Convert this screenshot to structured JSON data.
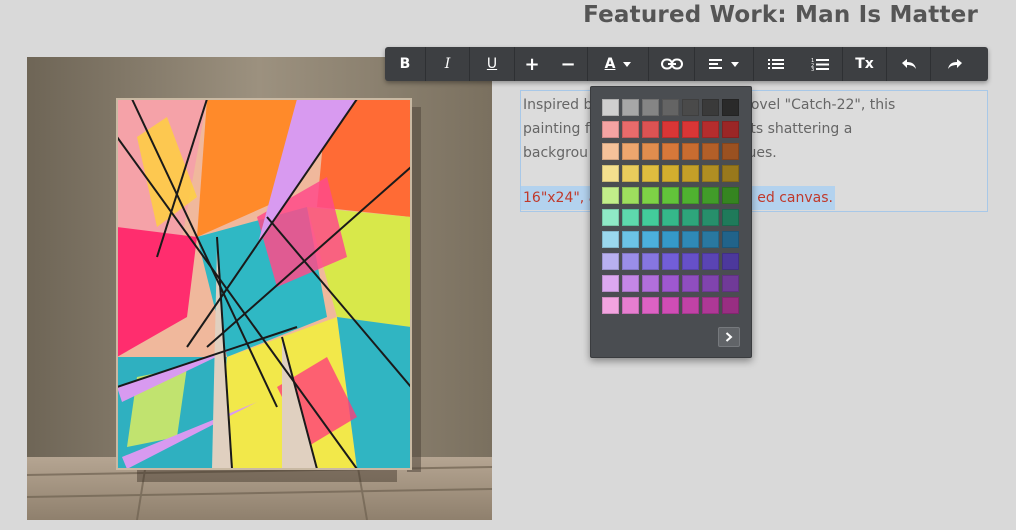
{
  "page": {
    "title": "Featured Work: Man Is Matter"
  },
  "editor": {
    "description": "Inspired by the Joseph Heller novel \"Catch-22\", this painting features original elements shattering a background of neon and pastel hues.",
    "description_visible": [
      "Inspired b",
      "oh Heller novel \"Catch-22\", this",
      "painting f",
      "l elements shattering a",
      "backgrou",
      "d pastel hues."
    ],
    "spec_visible": [
      "16\"x24\", a",
      "ed canvas."
    ]
  },
  "toolbar": {
    "bold_label": "B",
    "italic_label": "I",
    "underline_label": "U",
    "increase_label": "+",
    "decrease_label": "−",
    "color_label": "A",
    "clear_format_label": "Tx"
  },
  "palette": {
    "selected": "#d93636",
    "rows": [
      [
        "#cfcfcf",
        "#a7a7a7",
        "#858585",
        "#646464",
        "#4a4a4a",
        "#3a3a3a",
        "#2a2a2a"
      ],
      [
        "#f5a3a3",
        "#e86b6b",
        "#dc5353",
        "#d93636",
        "#d93636",
        "#b52d2d",
        "#9a2626"
      ],
      [
        "#f5c29a",
        "#eda66e",
        "#e08d4e",
        "#d6783a",
        "#c86c30",
        "#b35f28",
        "#9a5121"
      ],
      [
        "#f4e08e",
        "#e9cc5c",
        "#dfbd3f",
        "#d3ae2e",
        "#c49f28",
        "#b08e22",
        "#98781c"
      ],
      [
        "#c2ee8a",
        "#9ede5e",
        "#7ed246",
        "#62c43a",
        "#4fb230",
        "#419c29",
        "#358520"
      ],
      [
        "#8fe9c6",
        "#5ed9ad",
        "#43cc9b",
        "#35b88a",
        "#2ea57b",
        "#278f6b",
        "#1f7a5a"
      ],
      [
        "#9ad8ee",
        "#6cc3e6",
        "#4cb0dc",
        "#3599c8",
        "#2f89b6",
        "#2978a0",
        "#21638a"
      ],
      [
        "#b8b0f0",
        "#9a8ee8",
        "#8676e0",
        "#725ed8",
        "#6650c8",
        "#5a44b4",
        "#4c389c"
      ],
      [
        "#dca8f0",
        "#c487e6",
        "#b16fdc",
        "#9e58d0",
        "#8f4ec0",
        "#8044ae",
        "#703a98"
      ],
      [
        "#f2a4e0",
        "#e67ed0",
        "#dc62c4",
        "#cf4db5",
        "#c042a6",
        "#ae3896",
        "#982e82"
      ]
    ]
  }
}
